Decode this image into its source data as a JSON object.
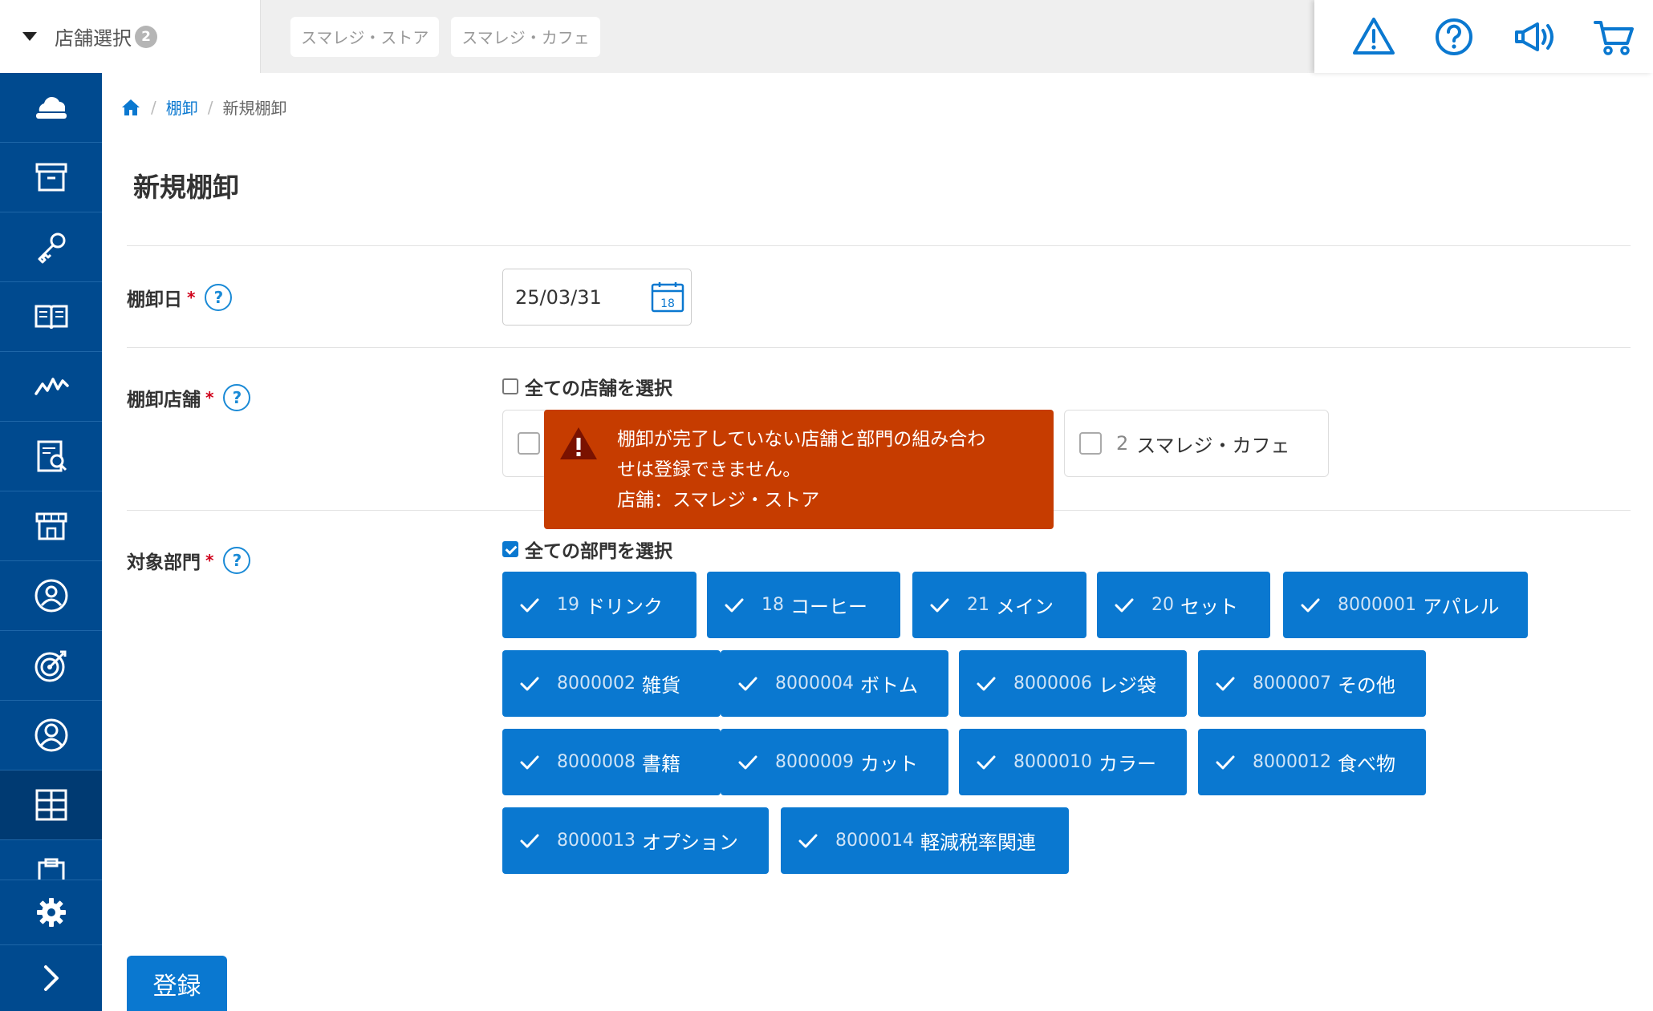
{
  "header": {
    "store_select_label": "店舗選択",
    "store_count": "2",
    "selected_stores": [
      "スマレジ・ストア",
      "スマレジ・カフェ"
    ],
    "icons": [
      "warning-icon",
      "help-icon",
      "megaphone-icon",
      "cart-icon"
    ]
  },
  "sidebar": {
    "items": [
      "cloud-icon",
      "archive-icon",
      "key-icon",
      "book-icon",
      "chart-icon",
      "report-icon",
      "store-icon",
      "user-circle-icon",
      "target-icon",
      "person-icon",
      "grid-icon",
      "clipboard-icon"
    ],
    "active_index": 10,
    "bottom": [
      "gear-icon",
      "chevron-right-icon"
    ]
  },
  "breadcrumb": {
    "parent": "棚卸",
    "current": "新規棚卸"
  },
  "page": {
    "title": "新規棚卸"
  },
  "form": {
    "date": {
      "label": "棚卸日",
      "required_mark": "*",
      "help": "?",
      "value": "25/03/31",
      "calendar_day": "18"
    },
    "stores": {
      "label": "棚卸店舗",
      "required_mark": "*",
      "help": "?",
      "select_all_label": "全ての店舗を選択",
      "select_all_checked": false,
      "options": [
        {
          "code": "",
          "name": "",
          "checked": false
        },
        {
          "code": "2",
          "name": "スマレジ・カフェ",
          "checked": false
        }
      ]
    },
    "departments": {
      "label": "対象部門",
      "required_mark": "*",
      "help": "?",
      "select_all_label": "全ての部門を選択",
      "select_all_checked": true,
      "items": [
        {
          "code": "19",
          "name": "ドリンク"
        },
        {
          "code": "18",
          "name": "コーヒー"
        },
        {
          "code": "21",
          "name": "メイン"
        },
        {
          "code": "20",
          "name": "セット"
        },
        {
          "code": "8000001",
          "name": "アパレル"
        },
        {
          "code": "8000002",
          "name": "雑貨"
        },
        {
          "code": "8000004",
          "name": "ボトム"
        },
        {
          "code": "8000006",
          "name": "レジ袋"
        },
        {
          "code": "8000007",
          "name": "その他"
        },
        {
          "code": "8000008",
          "name": "書籍"
        },
        {
          "code": "8000009",
          "name": "カット"
        },
        {
          "code": "8000010",
          "name": "カラー"
        },
        {
          "code": "8000012",
          "name": "食べ物"
        },
        {
          "code": "8000013",
          "name": "オプション"
        },
        {
          "code": "8000014",
          "name": "軽減税率関連"
        }
      ]
    },
    "submit_label": "登録"
  },
  "tooltip": {
    "line1": "棚卸が完了していない店舗と部門の組み合わ",
    "line2": "せは登録できません。",
    "line3": "店舗：スマレジ・ストア"
  },
  "colors": {
    "primary": "#0a78d0",
    "sidebar": "#004a8f",
    "error": "#c63c00",
    "required": "#d0021b"
  }
}
